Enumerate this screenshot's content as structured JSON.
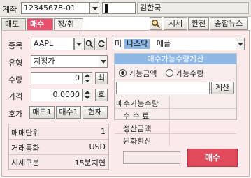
{
  "account": {
    "label": "계좌",
    "number": "12345678-01",
    "holder_name": "김한국"
  },
  "tabs": {
    "sell": "매도",
    "buy": "매수",
    "modify": "정/취"
  },
  "toolbar": {
    "quote": "시세",
    "exchange": "환전",
    "news": "종합뉴스"
  },
  "order": {
    "symbol_label": "종목",
    "symbol_value": "AAPL",
    "market_country": "미",
    "market_name": "나스닥",
    "stock_name": "애플",
    "type_label": "유형",
    "type_value": "지정가",
    "qty_label": "수량",
    "qty_value": "0",
    "qty_max_button": "최",
    "price_label": "가격",
    "price_value": "0.0000",
    "price_quote_button": "호",
    "quote_label": "호가",
    "quote_sell1": "매도1",
    "quote_buy1": "매수1",
    "quote_current": "현재"
  },
  "info": {
    "rows": [
      {
        "label": "매매단위",
        "value": "1"
      },
      {
        "label": "거래통화",
        "value": "USD"
      },
      {
        "label": "시세구분",
        "value": "15분지연"
      }
    ]
  },
  "calc": {
    "title": "매수가능수량계산",
    "radio_amount": "가능금액",
    "radio_qty": "가능수량",
    "calc_button": "계산",
    "rows": [
      {
        "label": "매수가능수량",
        "value": ""
      },
      {
        "label": "수 수 료",
        "value": ""
      },
      {
        "label": "정산금액",
        "value": ""
      },
      {
        "label": "원화환산",
        "value": ""
      }
    ]
  },
  "submit": {
    "label": "매수"
  },
  "colors": {
    "buy_accent": "#e14b5c",
    "panel_bg": "#fbeaea",
    "calc_header": "#8fb7e3",
    "market_badge": "#8fb7e3"
  }
}
